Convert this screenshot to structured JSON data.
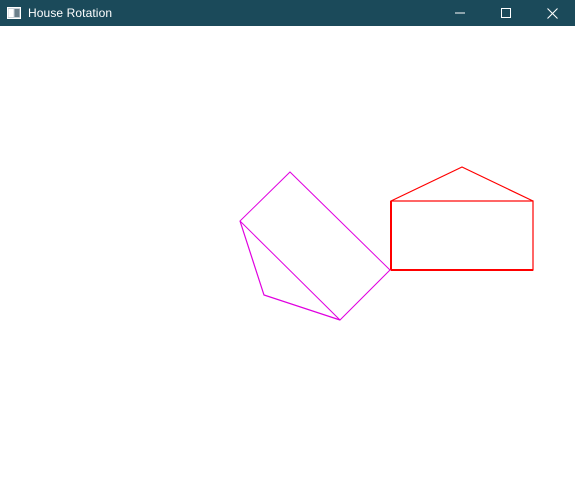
{
  "window": {
    "title": "House Rotation",
    "titlebar_color": "#1b4a5a",
    "controls": {
      "minimize_icon": "minimize-icon",
      "maximize_icon": "maximize-icon",
      "close_icon": "close-icon"
    }
  },
  "canvas": {
    "background": "#ffffff",
    "shapes": {
      "original_house": {
        "stroke": "#ff0000",
        "parts": [
          "roof",
          "body"
        ]
      },
      "rotated_house": {
        "stroke": "#e000e0",
        "parts": [
          "roof",
          "body"
        ]
      }
    }
  }
}
